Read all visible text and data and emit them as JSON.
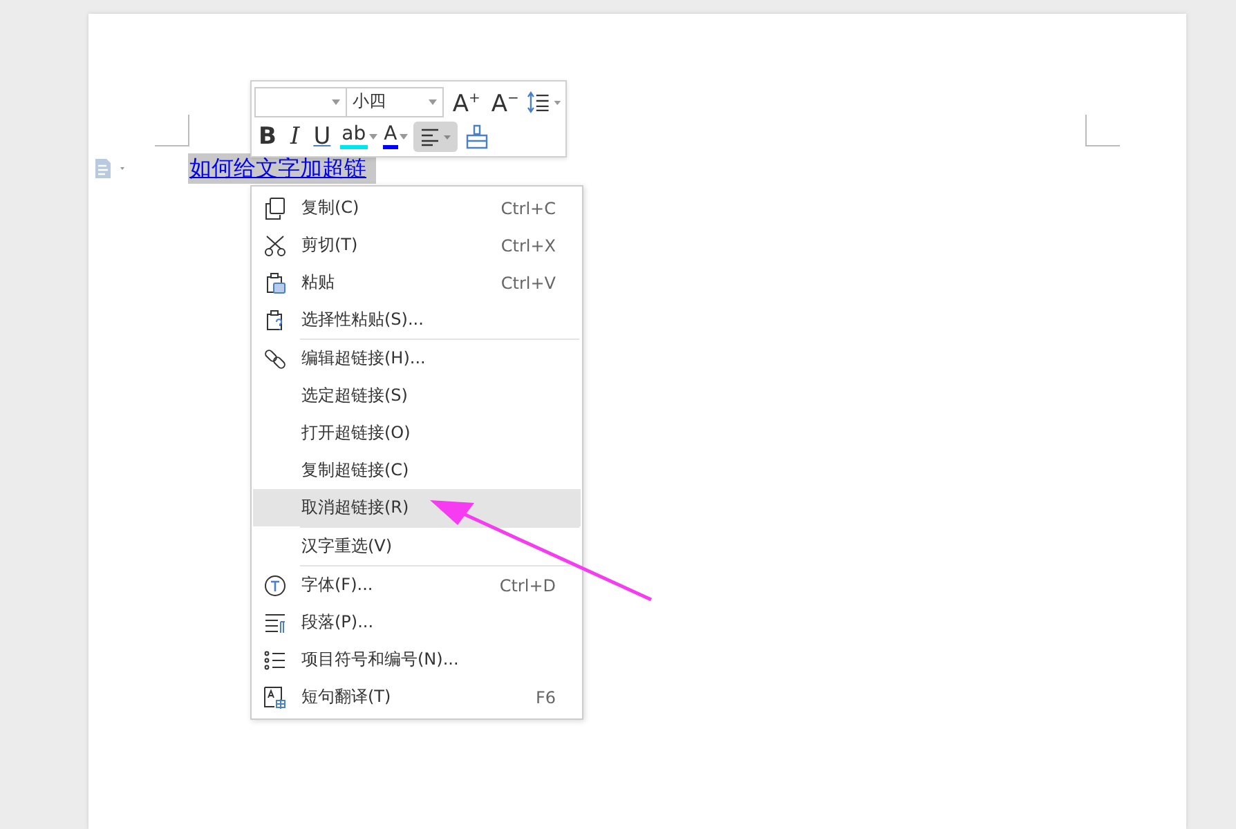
{
  "document": {
    "link_text": "如何给文字加超链",
    "selected": true
  },
  "toolbar": {
    "font_size": "小四",
    "row1": [
      {
        "kind": "grow",
        "glyph": "A$^{+}$"
      },
      {
        "kind": "shrink",
        "glyph": "A$^{−}$"
      },
      {
        "kind": "line-spacing"
      }
    ],
    "row2": [
      {
        "kind": "bold",
        "glyph": "B",
        "selected": false
      },
      {
        "kind": "italic",
        "glyph": "I",
        "selected": false
      },
      {
        "kind": "underline",
        "glyph": "U",
        "selected": false
      },
      {
        "kind": "highlight",
        "glyph": "ab",
        "color": "#00e5ee",
        "selected": false
      },
      {
        "kind": "font-color",
        "glyph": "A",
        "color": "#0000ff",
        "selected": false
      },
      {
        "kind": "align",
        "selected": true
      },
      {
        "kind": "painter",
        "selected": false
      }
    ]
  },
  "context_menu": [
    [
      {
        "kind": "copy",
        "label": "复制(C)",
        "shortcut": "Ctrl+C",
        "selected": false
      },
      {
        "kind": "cut",
        "label": "剪切(T)",
        "shortcut": "Ctrl+X",
        "selected": false
      },
      {
        "kind": "paste",
        "label": "粘贴",
        "shortcut": "Ctrl+V",
        "selected": false
      },
      {
        "kind": "paste-special",
        "label": "选择性粘贴(S)...",
        "selected": false
      }
    ],
    [
      {
        "kind": "link",
        "label": "编辑超链接(H)...",
        "selected": false
      },
      {
        "label": "选定超链接(S)",
        "selected": false
      },
      {
        "label": "打开超链接(O)",
        "selected": false
      },
      {
        "label": "复制超链接(C)",
        "selected": false
      },
      {
        "label": "取消超链接(R)",
        "selected": true
      }
    ],
    [
      {
        "label": "汉字重选(V)",
        "selected": false
      }
    ],
    [
      {
        "kind": "font",
        "label": "字体(F)...",
        "shortcut": "Ctrl+D",
        "selected": false
      },
      {
        "kind": "paragraph",
        "label": "段落(P)...",
        "selected": false
      },
      {
        "kind": "list",
        "label": "项目符号和编号(N)...",
        "selected": false
      },
      {
        "kind": "translate",
        "label": "短句翻译(T)",
        "shortcut": "F6",
        "selected": false
      }
    ]
  ]
}
